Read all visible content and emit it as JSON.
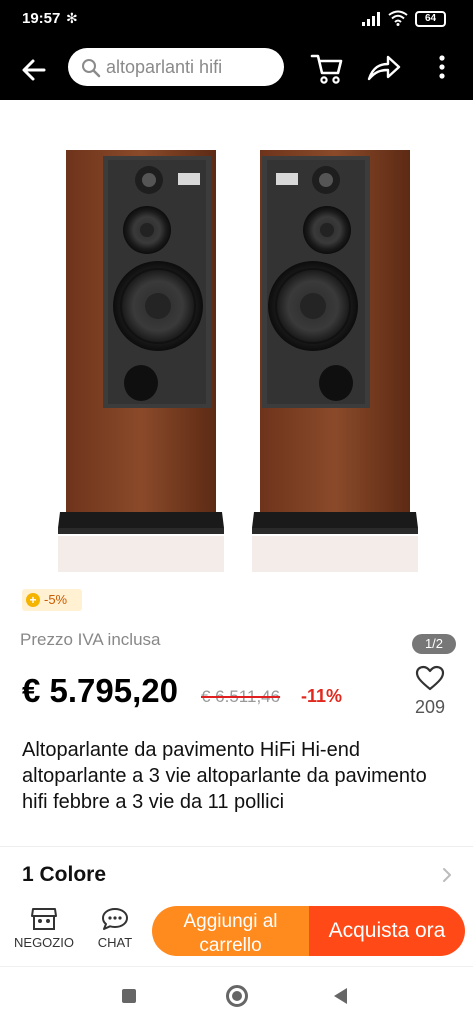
{
  "status_bar": {
    "time": "19:57",
    "battery": "64"
  },
  "top_bar": {
    "search_query": "altoparlanti hifi"
  },
  "product": {
    "image_counter": "1/2",
    "coupon": "-5%",
    "vat_label": "Prezzo IVA inclusa",
    "price": "€ 5.795,20",
    "original_price": "€ 6.511,46",
    "discount": "-11%",
    "wishlist_count": "209",
    "title": "Altoparlante da pavimento HiFi Hi-end altoparlante a 3 vie altoparlante da pavimento hifi febbre a 3 vie da 11 pollici"
  },
  "variants": {
    "color_label": "1 Colore"
  },
  "bottom_bar": {
    "store_label": "NEGOZIO",
    "chat_label": "CHAT",
    "add_to_cart_label": "Aggiungi al carrello",
    "buy_now_label": "Acquista ora"
  },
  "colors": {
    "add_to_cart": "#ff8a1e",
    "buy_now": "#ff4a17",
    "discount": "#e0281e",
    "header": "#000000"
  }
}
